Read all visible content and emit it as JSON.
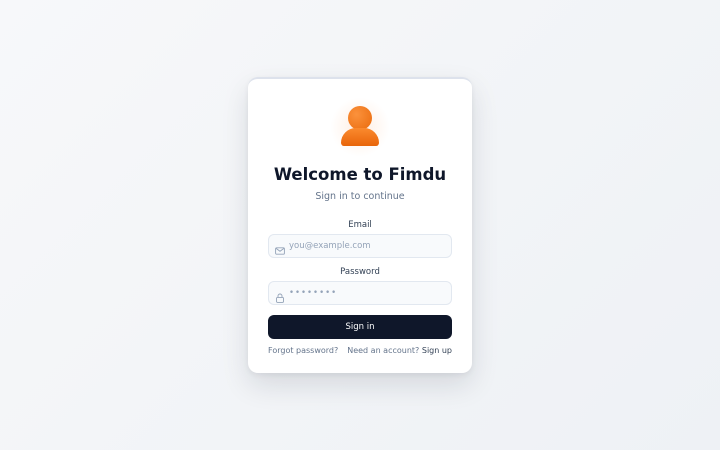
{
  "app": {
    "title": "Welcome to Fimdu",
    "subtitle": "Sign in to continue"
  },
  "form": {
    "email": {
      "label": "Email",
      "placeholder": "you@example.com",
      "value": "",
      "icon": "mail-icon"
    },
    "password": {
      "label": "Password",
      "placeholder": "••••••••",
      "value": "",
      "icon": "lock-icon"
    },
    "submit_label": "Sign in"
  },
  "footer": {
    "forgot_label": "Forgot password?",
    "account_prompt": "Need an account?",
    "signup_label": "Sign up"
  },
  "colors": {
    "brand_accent": "#f97316",
    "button_bg": "#0f172a",
    "background": "#f3f5f8"
  }
}
